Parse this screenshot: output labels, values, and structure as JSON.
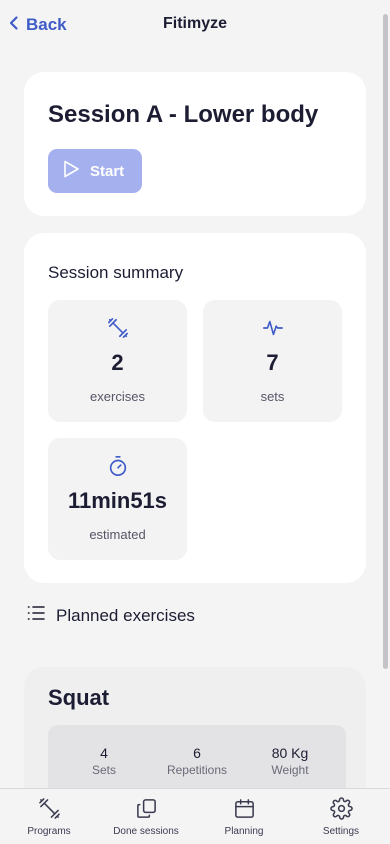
{
  "header": {
    "back_label": "Back",
    "app_title": "Fitimyze"
  },
  "session": {
    "title": "Session A - Lower body",
    "start_label": "Start"
  },
  "summary": {
    "title": "Session summary",
    "stats": [
      {
        "icon": "dumbbell-icon",
        "value": "2",
        "label": "exercises"
      },
      {
        "icon": "activity-icon",
        "value": "7",
        "label": "sets"
      },
      {
        "icon": "stopwatch-icon",
        "value": "11min51s",
        "label": "estimated"
      }
    ]
  },
  "planned": {
    "title": "Planned exercises",
    "icon": "list-icon"
  },
  "exercises": [
    {
      "name": "Squat",
      "stats": [
        {
          "value": "4",
          "label": "Sets"
        },
        {
          "value": "6",
          "label": "Repetitions"
        },
        {
          "value": "80 Kg",
          "label": "Weight"
        }
      ]
    }
  ],
  "nav": {
    "items": [
      {
        "icon": "dumbbell-icon",
        "label": "Programs"
      },
      {
        "icon": "copy-icon",
        "label": "Done sessions"
      },
      {
        "icon": "calendar-icon",
        "label": "Planning"
      },
      {
        "icon": "gear-icon",
        "label": "Settings"
      }
    ]
  },
  "colors": {
    "accent": "#3f5cc8",
    "start_button": "#a5b1ef",
    "background": "#f4f4f5",
    "text": "#1c1d33"
  }
}
